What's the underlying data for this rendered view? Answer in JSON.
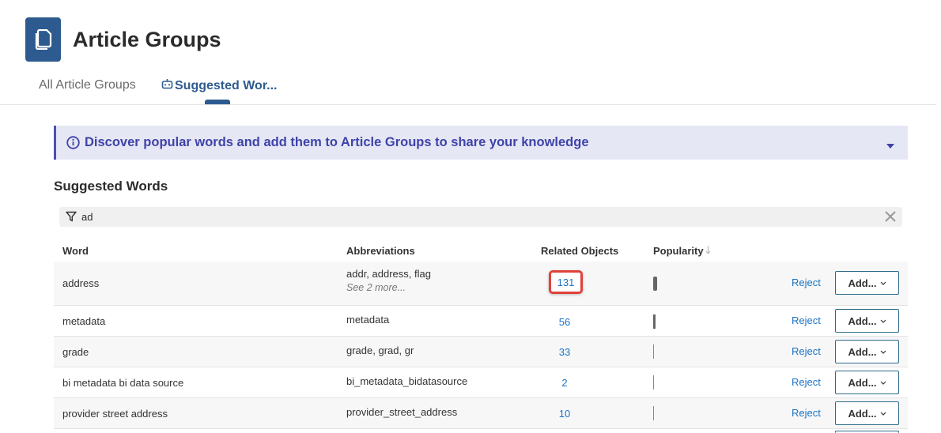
{
  "header": {
    "title": "Article Groups",
    "icon": "document-icon"
  },
  "tabs": [
    {
      "label": "All Article Groups",
      "active": false
    },
    {
      "label": "Suggested Wor...",
      "active": true,
      "icon": "robot-icon"
    }
  ],
  "banner": {
    "text": "Discover popular words and add them to Article Groups to share your knowledge"
  },
  "section": {
    "title": "Suggested Words"
  },
  "filter": {
    "value": "ad",
    "placeholder": ""
  },
  "table": {
    "columns": {
      "word": "Word",
      "abbreviations": "Abbreviations",
      "related": "Related Objects",
      "popularity": "Popularity"
    },
    "rows": [
      {
        "word": "address",
        "abbreviations": "addr, address, flag",
        "more": "See 2 more...",
        "related": "131",
        "popularity": 1.0
      },
      {
        "word": "metadata",
        "abbreviations": "metadata",
        "more": "",
        "related": "56",
        "popularity": 0.75
      },
      {
        "word": "grade",
        "abbreviations": "grade, grad, gr",
        "more": "",
        "related": "33",
        "popularity": 0.4
      },
      {
        "word": "bi metadata bi data source",
        "abbreviations": "bi_metadata_bidatasource",
        "more": "",
        "related": "2",
        "popularity": 0.4
      },
      {
        "word": "provider street address",
        "abbreviations": "provider_street_address",
        "more": "",
        "related": "10",
        "popularity": 0.4
      }
    ],
    "reject_label": "Reject",
    "add_label": "Add..."
  },
  "colors": {
    "brand": "#2e5b8f",
    "link": "#1a73c6",
    "banner_bg": "#e6e7f4",
    "banner_text": "#3e43a8",
    "highlight": "#e0413a"
  }
}
